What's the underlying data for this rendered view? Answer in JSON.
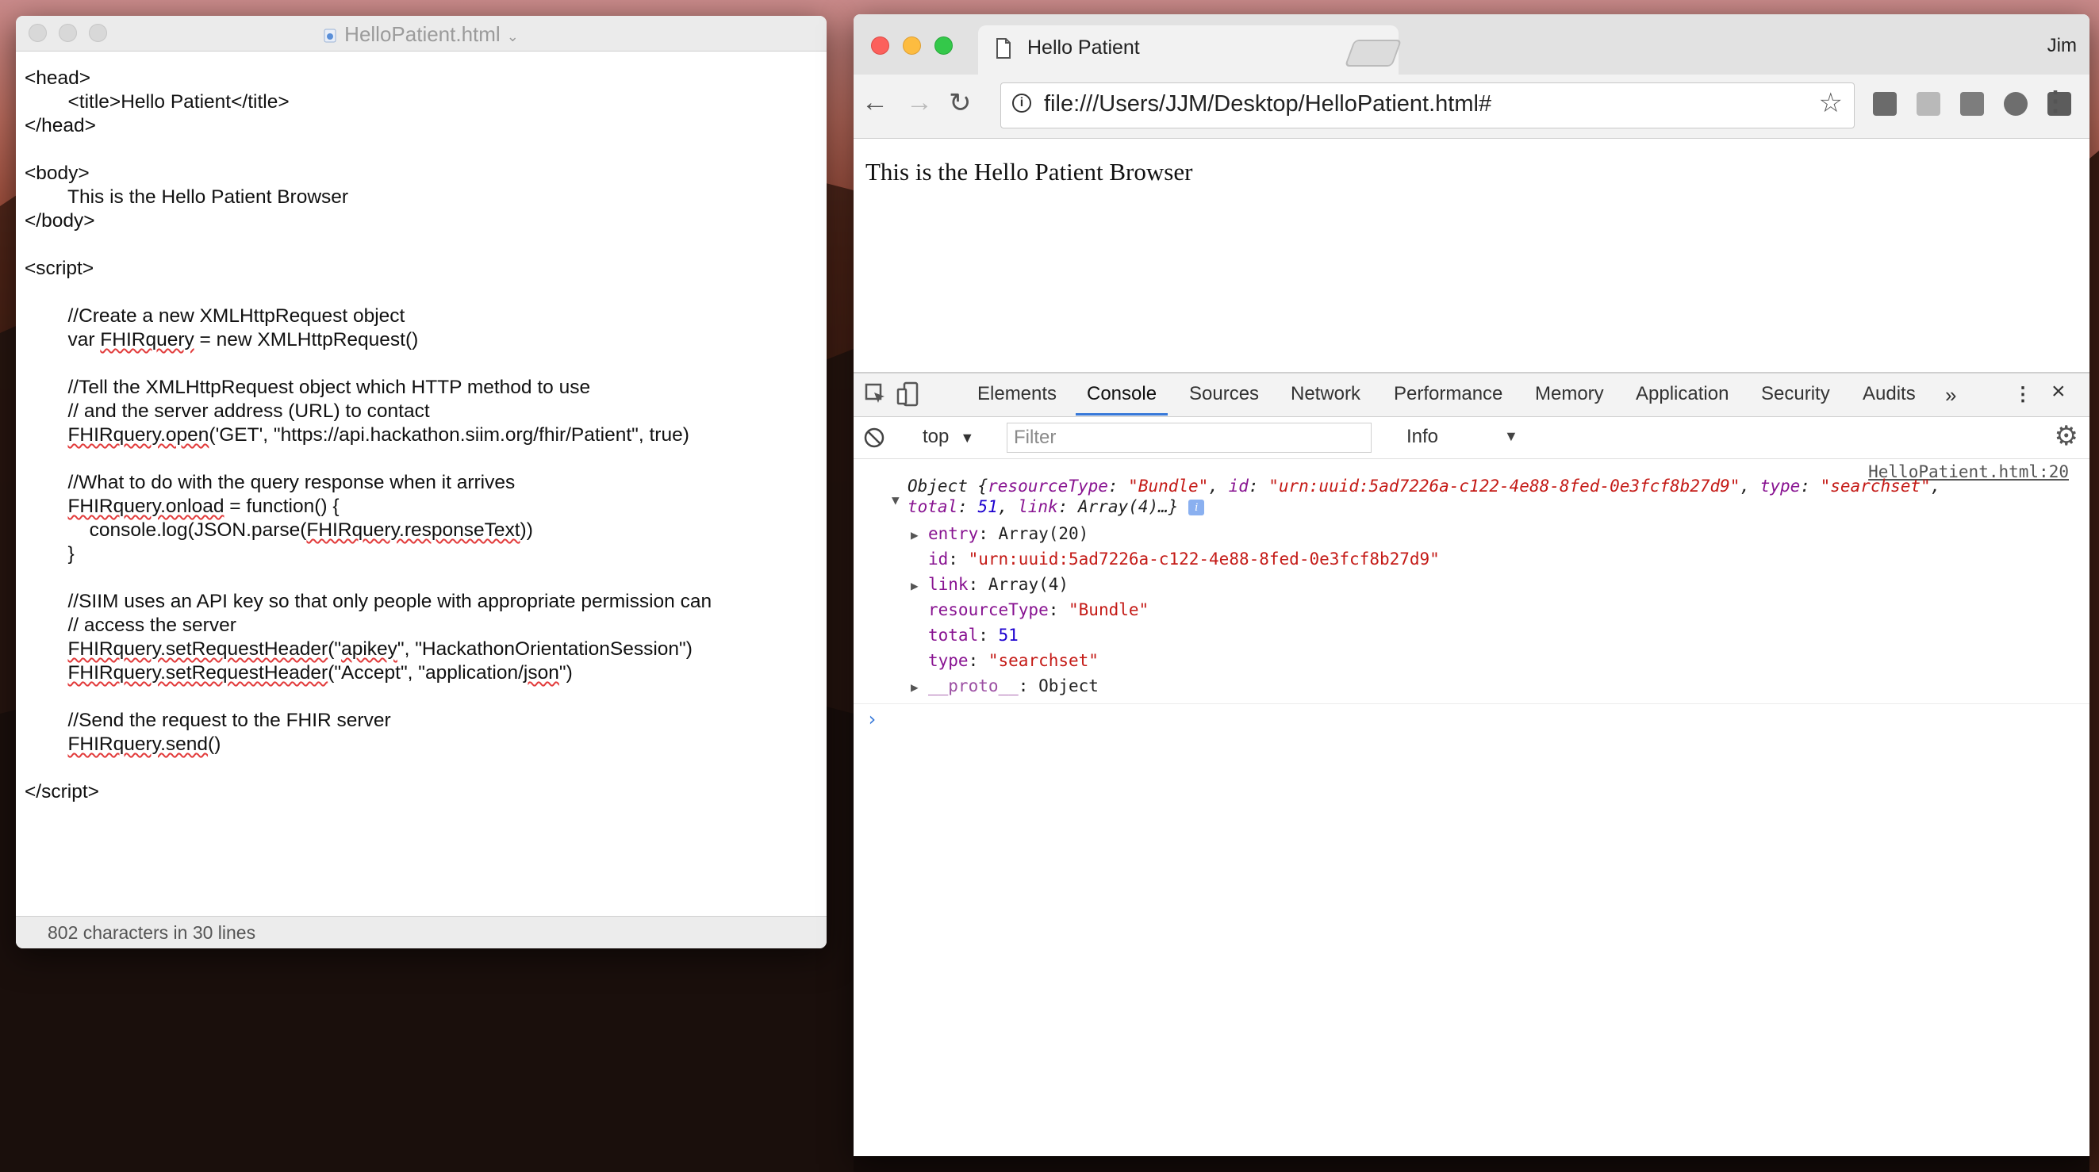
{
  "editor": {
    "window_title": "HelloPatient.html",
    "status": "802 characters in 30 lines"
  },
  "browser": {
    "user": "Jim",
    "tab_title": "Hello Patient",
    "url": "file:///Users/JJM/Desktop/HelloPatient.html#",
    "page_text": "This is the Hello Patient Browser",
    "devtools": {
      "tabs": [
        "Elements",
        "Console",
        "Sources",
        "Network",
        "Performance",
        "Memory",
        "Application",
        "Security",
        "Audits"
      ],
      "active_tab": "Console",
      "context": "top",
      "filter_placeholder": "Filter",
      "level": "Info",
      "source_link": "HelloPatient.html:20",
      "log": {
        "summary_prefix": "Object {",
        "resourceType": "\"Bundle\"",
        "id": "\"urn:uuid:5ad7226a-c122-4e88-8fed-0e3fcf8b27d9\"",
        "type": "\"searchset\"",
        "total": "51",
        "link_summary": "Array(4)",
        "entry_value": "Array(20)",
        "link_value": "Array(4)",
        "proto_value": "Object"
      }
    }
  }
}
